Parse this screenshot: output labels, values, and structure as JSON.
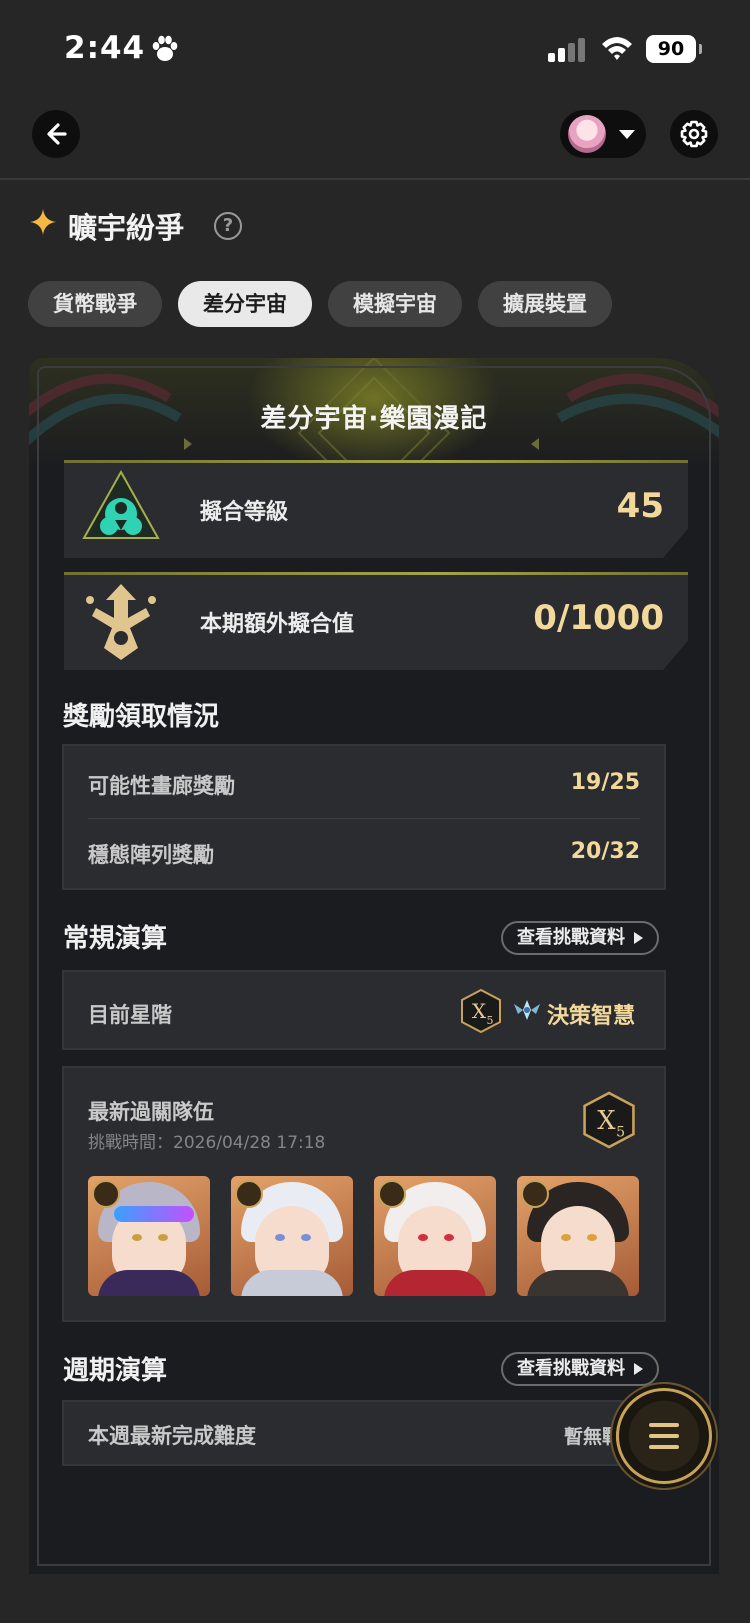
{
  "status_bar": {
    "time": "2:44",
    "battery": "90"
  },
  "header": {
    "section_title": "曠宇紛爭",
    "help": "?"
  },
  "tabs": [
    {
      "label": "貨幣戰爭",
      "active": false
    },
    {
      "label": "差分宇宙",
      "active": true
    },
    {
      "label": "模擬宇宙",
      "active": false
    },
    {
      "label": "擴展裝置",
      "active": false
    }
  ],
  "card": {
    "title": "差分宇宙·樂園漫記",
    "fit_level": {
      "label": "擬合等級",
      "value": "45"
    },
    "extra_fit": {
      "label": "本期額外擬合值",
      "value": "0/1000"
    }
  },
  "rewards": {
    "heading": "獎勵領取情況",
    "rows": [
      {
        "label": "可能性畫廊獎勵",
        "value": "19/25"
      },
      {
        "label": "穩態陣列獎勵",
        "value": "20/32"
      }
    ]
  },
  "regular": {
    "heading": "常規演算",
    "view_button": "查看挑戰資料",
    "current_rank_label": "目前星階",
    "rank_badge": "X",
    "rank_badge_sub": "5",
    "rank_name": "決策智慧",
    "team_title": "最新過關隊伍",
    "team_time": "挑戰時間：2026/04/28 17:18",
    "team_badge": "X",
    "team_badge_sub": "5"
  },
  "weekly": {
    "heading": "週期演算",
    "view_button": "查看挑戰資料",
    "row_label": "本週最新完成難度",
    "row_value": "暫無戰績"
  },
  "colors": {
    "accent_gold": "#f2d89a",
    "active_tab": "#e9e9e9",
    "background": "#262626"
  },
  "icons": [
    "paw-icon",
    "back-arrow-icon",
    "gear-icon",
    "star-icon",
    "help-icon",
    "fit-level-emblem-icon",
    "extra-fit-emblem-icon",
    "rank-wing-icon",
    "menu-icon"
  ]
}
